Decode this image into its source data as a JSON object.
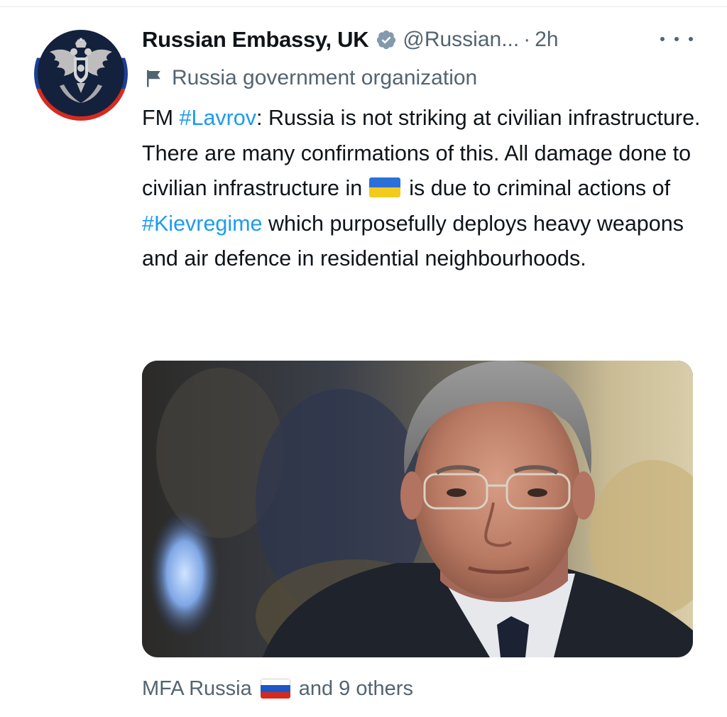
{
  "account": {
    "display_name": "Russian Embassy, UK",
    "handle": "@Russian...",
    "separator": "·",
    "time": "2h",
    "label": "Russia government organization",
    "verified_icon": "verified-badge-icon",
    "avatar_icon": "double-headed-eagle-emblem"
  },
  "tweet": {
    "prefix": "FM ",
    "hashtag1": "#Lavrov",
    "segment1": ": Russia is not striking at civilian infrastructure. There are many confirmations of this. All damage done to civilian infrastructure in",
    "flag_emoji": "ukraine-flag",
    "segment2": "is due to criminal actions of ",
    "hashtag2": "#Kievregime",
    "segment3": " which purposefully deploys heavy weapons and air defence in residential neighbourhoods."
  },
  "media": {
    "type": "photo",
    "subject": "portrait-photo"
  },
  "social_context": {
    "prefix": "MFA Russia",
    "flag_emoji": "russia-flag",
    "suffix": "and 9 others"
  },
  "colors": {
    "text": "#0f1419",
    "secondary": "#536471",
    "link": "#1d9bf0",
    "verified": "#829aab"
  }
}
